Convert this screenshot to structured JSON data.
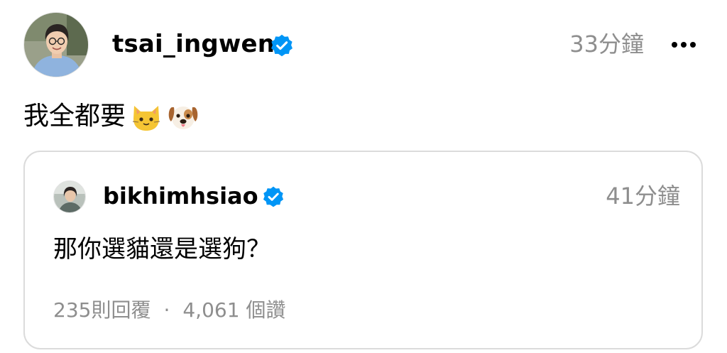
{
  "post": {
    "username": "tsai_ingwen",
    "verified": true,
    "timestamp": "33分鐘",
    "more_icon": "more-horizontal-icon",
    "text": "我全都要",
    "emojis": [
      "cat-face-icon",
      "dog-face-icon"
    ]
  },
  "quoted_post": {
    "username": "bikhimhsiao",
    "verified": true,
    "timestamp": "41分鐘",
    "text": "那你選貓還是選狗？",
    "replies_label": "235則回覆",
    "separator": "·",
    "likes_label": "4,061 個讚"
  },
  "colors": {
    "verified_blue": "#0095f6",
    "secondary_text": "#8e8e8e",
    "card_border": "#dbdbdb"
  }
}
